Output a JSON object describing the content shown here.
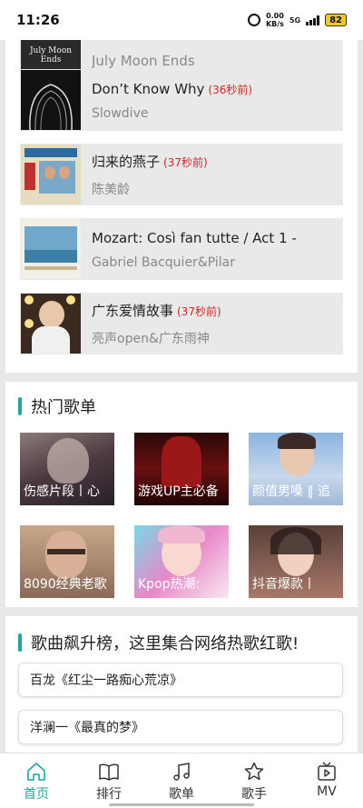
{
  "status": {
    "time": "11:26",
    "net_speed": "0.00",
    "net_unit": "KB/s",
    "signal_label": "5G",
    "battery": "82"
  },
  "recent": {
    "partial_title": "July Moon Ends",
    "partial_cover_text": "July Moon Ends",
    "items": [
      {
        "title": "Don’t Know Why",
        "time": "(36秒前)",
        "artist": "Slowdive"
      },
      {
        "title": "归来的燕子",
        "time": "(37秒前)",
        "artist": "陈美龄"
      },
      {
        "title": "Mozart: Così fan tutte / Act 1 -",
        "time": "",
        "artist": "Gabriel Bacquier&Pilar"
      },
      {
        "title": "广东爱情故事",
        "time": "(37秒前)",
        "artist": "亮声open&广东雨神"
      }
    ]
  },
  "hot_playlists": {
    "title": "热门歌单",
    "items": [
      {
        "name": "伤感片段丨心"
      },
      {
        "name": "游戏UP主必备"
      },
      {
        "name": "颜值男嗓 ‖ 追"
      },
      {
        "name": "8090经典老歌"
      },
      {
        "name": "Kpop热潮:"
      },
      {
        "name": "抖音爆款丨"
      }
    ]
  },
  "rank": {
    "title": "歌曲飙升榜，这里集合网络热歌红歌!",
    "items": [
      {
        "text": "百龙《红尘一路痴心荒凉》"
      },
      {
        "text": "洋澜一《最真的梦》"
      }
    ]
  },
  "tabs": [
    {
      "label": "首页",
      "icon": "home-icon"
    },
    {
      "label": "排行",
      "icon": "book-icon"
    },
    {
      "label": "歌单",
      "icon": "music-note-icon"
    },
    {
      "label": "歌手",
      "icon": "star-icon"
    },
    {
      "label": "MV",
      "icon": "tv-icon"
    }
  ],
  "colors": {
    "accent": "#1fa6a0",
    "time_red": "#d42424",
    "artist_gray": "#888888"
  }
}
